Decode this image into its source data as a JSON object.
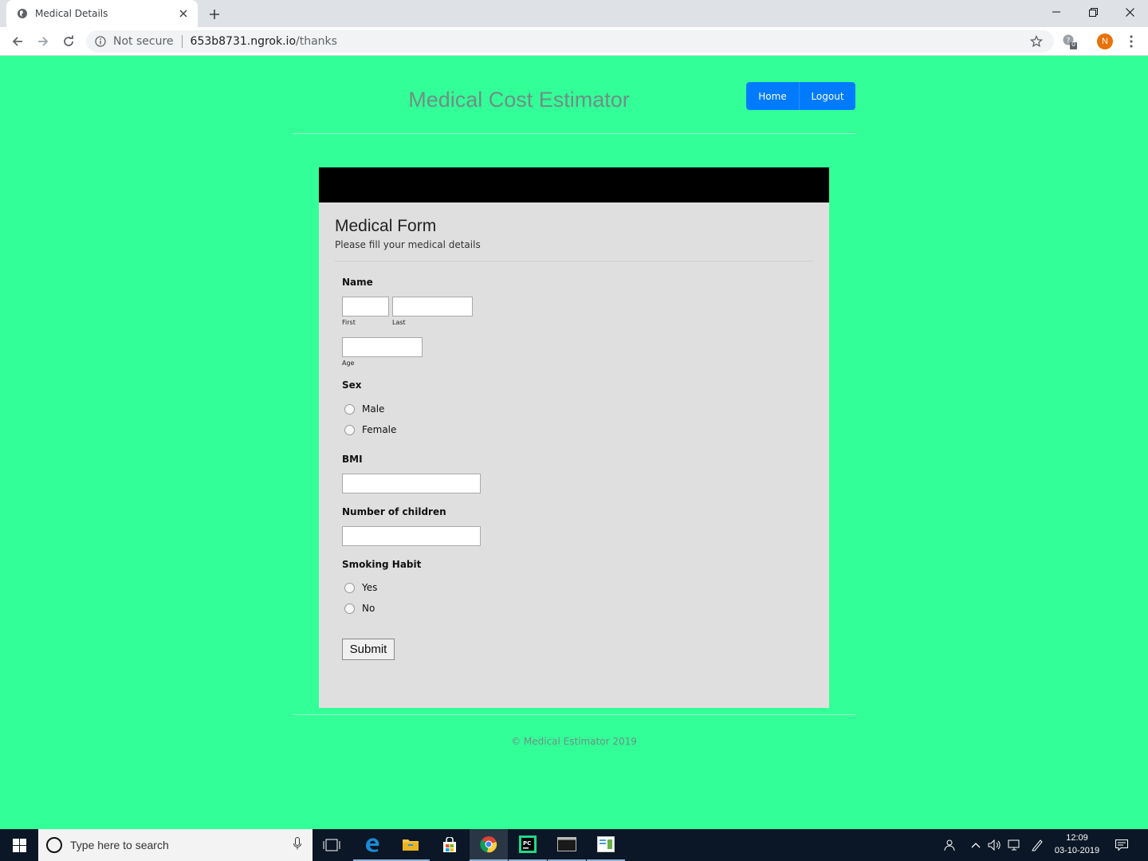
{
  "browser": {
    "tab_title": "Medical Details",
    "security_label": "Not secure",
    "url_host": "653b8731.ngrok.io",
    "url_path": "/thanks",
    "profile_initial": "N",
    "extension_badge": "0"
  },
  "header": {
    "title": "Medical Cost Estimator",
    "nav": {
      "home": "Home",
      "logout": "Logout"
    }
  },
  "form": {
    "title": "Medical Form",
    "subtitle": "Please fill your medical details",
    "name_label": "Name",
    "first_sublabel": "First",
    "last_sublabel": "Last",
    "age_sublabel": "Age",
    "sex_label": "Sex",
    "sex_options": [
      "Male",
      "Female"
    ],
    "bmi_label": "BMI",
    "children_label": "Number of children",
    "smoking_label": "Smoking Habit",
    "smoking_options": [
      "Yes",
      "No"
    ],
    "submit_label": "Submit"
  },
  "footer": {
    "text": "© Medical Estimator 2019"
  },
  "taskbar": {
    "search_placeholder": "Type here to search",
    "time": "12:09",
    "date": "03-10-2019",
    "pinned_icons": [
      "task-view-icon",
      "edge-icon",
      "file-explorer-icon",
      "store-icon",
      "chrome-icon",
      "pycharm-icon",
      "terminal-icon",
      "notes-icon"
    ]
  },
  "colors": {
    "page_background": "#33ff99",
    "nav_button": "#007bff",
    "card_background": "#dfdfdf",
    "card_header": "#000000",
    "title_text": "#6f8f82"
  }
}
